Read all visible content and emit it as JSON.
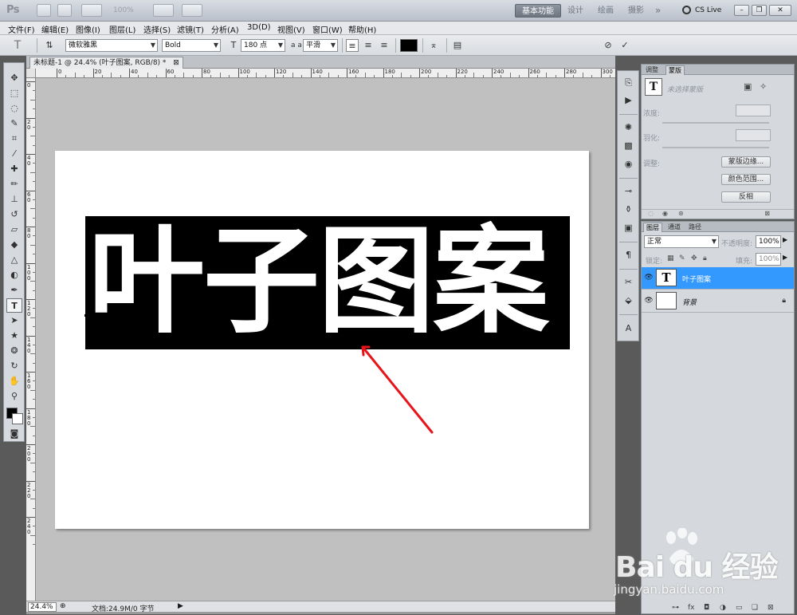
{
  "app": {
    "logo": "Ps",
    "zoom_box": "100%",
    "workspaces": [
      "基本功能",
      "设计",
      "绘画",
      "摄影"
    ],
    "more": "»",
    "cs_live": "CS Live",
    "window_controls": [
      "–",
      "❐",
      "✕"
    ]
  },
  "menu": [
    "文件(F)",
    "编辑(E)",
    "图像(I)",
    "图层(L)",
    "选择(S)",
    "滤镜(T)",
    "分析(A)",
    "3D(D)",
    "视图(V)",
    "窗口(W)",
    "帮助(H)"
  ],
  "options": {
    "tool_icon": "T",
    "font_family": "微软雅黑",
    "font_style": "Bold",
    "font_size": "180 点",
    "aa_label": "a a",
    "aa_mode": "平滑",
    "text_color": "#000000"
  },
  "document": {
    "tab_title": "未标题-1 @ 24.4% (叶子图案, RGB/8) *",
    "tab_close": "⊠",
    "ruler_h": [
      "0",
      "20",
      "40",
      "60",
      "80",
      "100",
      "120",
      "140",
      "160",
      "180",
      "200",
      "220",
      "240",
      "260",
      "280",
      "300"
    ],
    "ruler_v": [
      "0",
      "2 0",
      "4 0",
      "6 0",
      "8 0",
      "1 0 0",
      "1 2 0",
      "1 4 0",
      "1 6 0",
      "1 8 0",
      "2 0 0",
      "2 2 0",
      "2 4 0"
    ],
    "canvas_text": "叶子图案",
    "zoom": "24.4%",
    "doc_info": "文档:24.9M/0 字节"
  },
  "masks_panel": {
    "tabs": [
      "调整",
      "蒙版"
    ],
    "no_selection": "未选择蒙版",
    "density": "浓度:",
    "feather": "羽化:",
    "refine": "调整:",
    "btn_edge": "蒙版边缘...",
    "btn_range": "颜色范围...",
    "btn_invert": "反相"
  },
  "layers_panel": {
    "tabs": [
      "图层",
      "通道",
      "路径"
    ],
    "blend_mode": "正常",
    "opacity_label": "不透明度:",
    "opacity": "100%",
    "lock_label": "锁定:",
    "fill_label": "填充:",
    "fill": "100%",
    "layers": [
      {
        "name": "叶子图案",
        "thumb": "T",
        "selected": true
      },
      {
        "name": "背景",
        "thumb": "",
        "selected": false,
        "locked": true
      }
    ]
  },
  "watermark": {
    "brand": "Bai du 经验",
    "url": "jingyan.baidu.com"
  },
  "colors": {
    "selection": "#3399ff",
    "arrow": "#e8141b"
  }
}
